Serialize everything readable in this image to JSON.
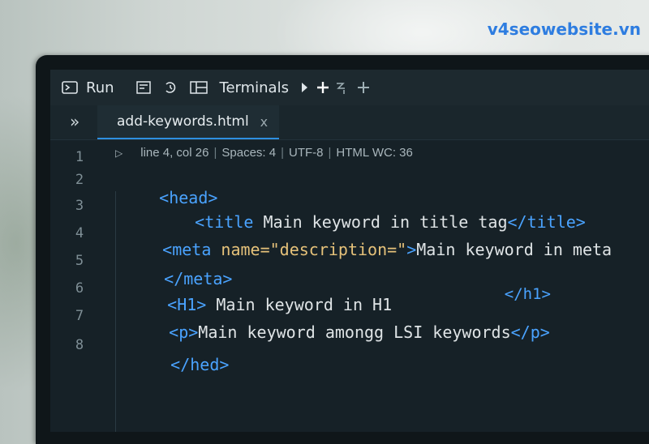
{
  "watermark": "v4seowebsite.vn",
  "toolbar": {
    "run_label": "Run",
    "terminals_label": "Terminals",
    "icons": [
      "terminal-icon",
      "debug-console-icon",
      "history-icon",
      "panel-layout-icon",
      "play-icon",
      "add-icon",
      "split-terminal-icon",
      "new-icon"
    ]
  },
  "tabbar": {
    "chevron": "»",
    "tab_name": "add-keywords.html",
    "tab_close": "x"
  },
  "status": {
    "position": "line 4, col 26",
    "spaces": "Spaces: 4",
    "encoding": "UTF-8",
    "mode": "HTML WC: 36"
  },
  "line_numbers": [
    "1",
    "2",
    "3",
    "4",
    "5",
    "6",
    "7",
    "8"
  ],
  "code": {
    "l2": {
      "open": "<head>"
    },
    "l3": {
      "open": "<title",
      "text": " Main keyword in title tag",
      "close": "</title>"
    },
    "l4": {
      "open": "<meta",
      "attr": " name=",
      "value": "\"description=\"",
      "gt": ">",
      "text": "Main keyword in meta"
    },
    "l5": {
      "close": "</meta>"
    },
    "l6": {
      "open": "<H1>",
      "text": " Main keyword in H1",
      "close": "</h1>"
    },
    "l7": {
      "open": "<p>",
      "text": "Main keyword amongg LSI keywords",
      "close": "</p>"
    },
    "l8": {
      "close": "</hed>"
    }
  }
}
